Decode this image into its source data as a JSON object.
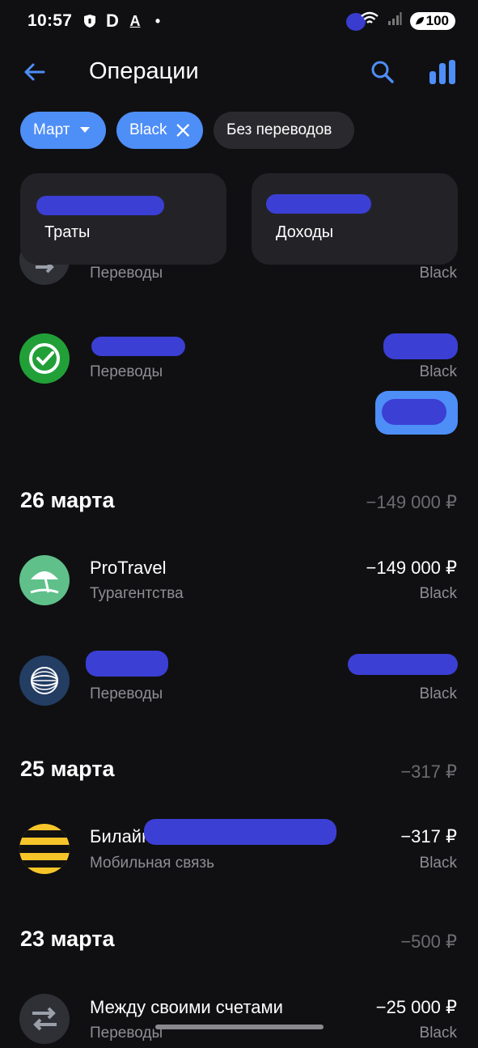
{
  "status_bar": {
    "time": "10:57",
    "battery": "100",
    "icons": [
      "shield-icon",
      "d-app-icon",
      "a-app-icon",
      "dot-icon",
      "wifi-icon",
      "signal-icon"
    ]
  },
  "header": {
    "title": "Операции",
    "icons": [
      "back-arrow-icon",
      "search-icon",
      "bar-chart-icon"
    ]
  },
  "filters": {
    "month": "Март",
    "card": "Black",
    "transfers": "Без переводов"
  },
  "summary": {
    "spend_label": "Траты",
    "income_label": "Доходы"
  },
  "items": [
    {
      "category": "Переводы",
      "account": "Black"
    },
    {
      "category": "Переводы",
      "account": "Black"
    }
  ],
  "groups": [
    {
      "date": "26 марта",
      "total": "−149 000 ₽",
      "items": [
        {
          "name": "ProTravel",
          "category": "Турагентства",
          "amount": "−149 000 ₽",
          "account": "Black"
        },
        {
          "category": "Переводы",
          "account": "Black"
        }
      ]
    },
    {
      "date": "25 марта",
      "total": "−317 ₽",
      "items": [
        {
          "name": "Билайн +",
          "category": "Мобильная связь",
          "amount": "−317 ₽",
          "account": "Black"
        }
      ]
    },
    {
      "date": "23 марта",
      "total": "−500 ₽",
      "items": [
        {
          "name": "Между своими счетами",
          "category": "Переводы",
          "amount": "−25 000 ₽",
          "account": "Black"
        }
      ]
    }
  ],
  "colors": {
    "background": "#101012",
    "accent": "#4e8ef7",
    "card": "#232327",
    "muted": "#8e8e93",
    "redaction": "#3b3fd4"
  }
}
